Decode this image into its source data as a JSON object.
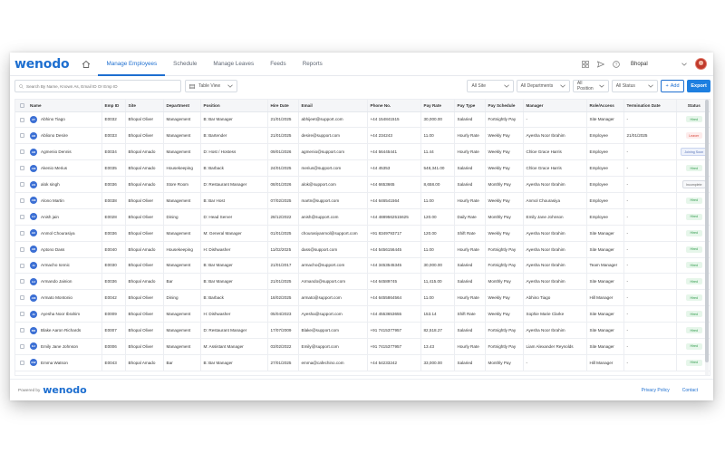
{
  "app": {
    "logo": "wenodo"
  },
  "nav": {
    "home_icon": "home-icon",
    "tabs": [
      {
        "label": "Manage Employees",
        "active": true
      },
      {
        "label": "Schedule"
      },
      {
        "label": "Manage Leaves"
      },
      {
        "label": "Feeds"
      },
      {
        "label": "Reports"
      }
    ]
  },
  "header": {
    "site_selected": "Bhopal"
  },
  "toolbar": {
    "search_placeholder": "Search By Name, Known As, Email ID Or Emp ID",
    "view_label": "Table View",
    "filters": {
      "site": "All Site",
      "department": "All Departments",
      "position": "All Position",
      "status": "All Status"
    },
    "add_label": "Add",
    "export_label": "Export"
  },
  "table": {
    "columns": [
      "Name",
      "Emp ID",
      "Site",
      "Department",
      "Position",
      "Hire Date",
      "Email",
      "Phone No.",
      "Pay Rate",
      "Pay Type",
      "Pay Schedule",
      "Manager",
      "Role/Access",
      "Termination Date",
      "Status"
    ],
    "rows": [
      {
        "initials": "AT",
        "name": "Abhino Tiago",
        "emp_id": "E0032",
        "site": "Bhopal Oliver",
        "department": "Management",
        "position": "B: Bar Manager",
        "hire_date": "21/01/2025",
        "email": "abhijeet@support.com",
        "phone": "+44 154841515",
        "pay_rate": "30,000.00",
        "pay_type": "Salaried",
        "pay_schedule": "Fortnightly Pay",
        "manager": "-",
        "role": "Site Manager",
        "termination": "-",
        "status": "Hired",
        "status_kind": "hired"
      },
      {
        "initials": "AD",
        "name": "Abliono Desire",
        "emp_id": "E0033",
        "site": "Bhopal Oliver",
        "department": "Management",
        "position": "B: Bartender",
        "hire_date": "21/01/2025",
        "email": "desire@support.com",
        "phone": "+44 234243",
        "pay_rate": "11.00",
        "pay_type": "Hourly Rate",
        "pay_schedule": "Weekly Pay",
        "manager": "Ayesha Noor Ibrahim",
        "role": "Employee",
        "termination": "21/01/2025",
        "status": "Leaver",
        "status_kind": "leaver"
      },
      {
        "initials": "AD",
        "name": "Agmenio Dennis",
        "emp_id": "E0034",
        "site": "Bhopal Amado",
        "department": "Management",
        "position": "D: Host / Hostess",
        "hire_date": "09/01/2026",
        "email": "agmenio@support.com",
        "phone": "+44 56445441",
        "pay_rate": "11.44",
        "pay_type": "Hourly Rate",
        "pay_schedule": "Weekly Pay",
        "manager": "Chloe Grace Harris",
        "role": "Employee",
        "termination": "-",
        "status": "Joining Soon",
        "status_kind": "joining"
      },
      {
        "initials": "AM",
        "name": "Akenio Merius",
        "emp_id": "E0035",
        "site": "Bhopal Amado",
        "department": "Housekeeping",
        "position": "B: Barback",
        "hire_date": "24/01/2025",
        "email": "merius@support.com",
        "phone": "+44 45353",
        "pay_rate": "548,341.00",
        "pay_type": "Salaried",
        "pay_schedule": "Weekly Pay",
        "manager": "Chloe Grace Harris",
        "role": "Employee",
        "termination": "-",
        "status": "Hired",
        "status_kind": "hired"
      },
      {
        "initials": "AS",
        "name": "alok singh",
        "emp_id": "E0036",
        "site": "Bhopal Amado",
        "department": "Store Room",
        "position": "D: Restaurant Manager",
        "hire_date": "08/01/2026",
        "email": "alok@support.com",
        "phone": "+44 6653665",
        "pay_rate": "8,658.00",
        "pay_type": "Salaried",
        "pay_schedule": "Monthly Pay",
        "manager": "Ayesha Noor Ibrahim",
        "role": "Employee",
        "termination": "-",
        "status": "Incomplete",
        "status_kind": "incomplete"
      },
      {
        "initials": "AM",
        "name": "Alono Martin",
        "emp_id": "E0038",
        "site": "Bhopal Oliver",
        "department": "Management",
        "position": "B: Bar Host",
        "hire_date": "07/02/2025",
        "email": "martn@support.com",
        "phone": "+44 646541564",
        "pay_rate": "11.00",
        "pay_type": "Hourly Rate",
        "pay_schedule": "Weekly Pay",
        "manager": "Anmol Chourasiya",
        "role": "Employee",
        "termination": "-",
        "status": "Hired",
        "status_kind": "hired"
      },
      {
        "initials": "AJ",
        "name": "Anish jain",
        "emp_id": "E0028",
        "site": "Bhopal Oliver",
        "department": "Dining",
        "position": "D: Head Server",
        "hire_date": "28/12/2022",
        "email": "anish@support.com",
        "phone": "+44 4889562515625",
        "pay_rate": "120.00",
        "pay_type": "Daily Rate",
        "pay_schedule": "Monthly Pay",
        "manager": "Emily Jane Johnson",
        "role": "Employee",
        "termination": "-",
        "status": "Hired",
        "status_kind": "hired"
      },
      {
        "initials": "AC",
        "name": "Anmol Chourasiya",
        "emp_id": "E0036",
        "site": "Bhopal Oliver",
        "department": "Management",
        "position": "M: General Manager",
        "hire_date": "01/01/2025",
        "email": "chourasiyanmol@support.com",
        "phone": "+91 8349793717",
        "pay_rate": "120.00",
        "pay_type": "Shift Rate",
        "pay_schedule": "Weekly Pay",
        "manager": "Ayesha Noor Ibrahim",
        "role": "Site Manager",
        "termination": "-",
        "status": "Hired",
        "status_kind": "hired"
      },
      {
        "initials": "AD",
        "name": "Aptono Dass",
        "emp_id": "E0040",
        "site": "Bhopal Amado",
        "department": "Housekeeping",
        "position": "H: Dishwasher",
        "hire_date": "11/02/2025",
        "email": "dass@support.com",
        "phone": "+44 5456156445",
        "pay_rate": "11.00",
        "pay_type": "Hourly Rate",
        "pay_schedule": "Fortnightly Pay",
        "manager": "Ayesha Noor Ibrahim",
        "role": "Site Manager",
        "termination": "-",
        "status": "Hired",
        "status_kind": "hired"
      },
      {
        "initials": "AI",
        "name": "Armacho Ionnic",
        "emp_id": "E0030",
        "site": "Bhopal Oliver",
        "department": "Management",
        "position": "B: Bar Manager",
        "hire_date": "21/01/2017",
        "email": "armacho@support.com",
        "phone": "+44 3453545345",
        "pay_rate": "30,000.00",
        "pay_type": "Salaried",
        "pay_schedule": "Fortnightly Pay",
        "manager": "Ayesha Noor Ibrahim",
        "role": "Team Manager",
        "termination": "-",
        "status": "Hired",
        "status_kind": "hired"
      },
      {
        "initials": "AJ",
        "name": "Armando Jainion",
        "emp_id": "E0036",
        "site": "Bhopal Amado",
        "department": "Bar",
        "position": "B: Bar Manager",
        "hire_date": "21/01/2025",
        "email": "Armando@support.com",
        "phone": "+44 64589745",
        "pay_rate": "11,415.00",
        "pay_type": "Salaried",
        "pay_schedule": "Monthly Pay",
        "manager": "Ayesha Noor Ibrahim",
        "role": "Site Manager",
        "termination": "-",
        "status": "Hired",
        "status_kind": "hired"
      },
      {
        "initials": "AM",
        "name": "Armato Montonio",
        "emp_id": "E0042",
        "site": "Bhopal Oliver",
        "department": "Dining",
        "position": "B: Barback",
        "hire_date": "18/02/2025",
        "email": "armato@support.com",
        "phone": "+44 6455864564",
        "pay_rate": "11.00",
        "pay_type": "Hourly Rate",
        "pay_schedule": "Weekly Pay",
        "manager": "Abhino Tiago",
        "role": "Hill Manager",
        "termination": "-",
        "status": "Hired",
        "status_kind": "hired"
      },
      {
        "initials": "AI",
        "name": "Ayesha Noor Ibrahim",
        "emp_id": "E0009",
        "site": "Bhopal Oliver",
        "department": "Management",
        "position": "H: Dishwasher",
        "hire_date": "05/04/2023",
        "email": "Ayesha@support.com",
        "phone": "+44 4553653655",
        "pay_rate": "153.14",
        "pay_type": "Shift Rate",
        "pay_schedule": "Weekly Pay",
        "manager": "Sophie Marie Clarke",
        "role": "Site Manager",
        "termination": "-",
        "status": "Hired",
        "status_kind": "hired"
      },
      {
        "initials": "BR",
        "name": "Blake Aaron Richards",
        "emp_id": "E0007",
        "site": "Bhopal Oliver",
        "department": "Management",
        "position": "D: Restaurant Manager",
        "hire_date": "17/07/2009",
        "email": "Blake@support.com",
        "phone": "+91 7415377957",
        "pay_rate": "82,518.27",
        "pay_type": "Salaried",
        "pay_schedule": "Fortnightly Pay",
        "manager": "Ayesha Noor Ibrahim",
        "role": "Site Manager",
        "termination": "-",
        "status": "Hired",
        "status_kind": "hired"
      },
      {
        "initials": "EJ",
        "name": "Emily Jane Johnson",
        "emp_id": "E0006",
        "site": "Bhopal Oliver",
        "department": "Management",
        "position": "M: Assistant Manager",
        "hire_date": "03/02/2022",
        "email": "Emily@support.com",
        "phone": "+91 7415377957",
        "pay_rate": "13.43",
        "pay_type": "Hourly Rate",
        "pay_schedule": "Fortnightly Pay",
        "manager": "Liam Alexander Reynolds",
        "role": "Site Manager",
        "termination": "-",
        "status": "Hired",
        "status_kind": "hired"
      },
      {
        "initials": "EW",
        "name": "Emma Watson",
        "emp_id": "E0043",
        "site": "Bhopal Amado",
        "department": "Bar",
        "position": "B: Bar Manager",
        "hire_date": "27/01/2025",
        "email": "emma@cafechino.com",
        "phone": "+44 54233242",
        "pay_rate": "33,000.00",
        "pay_type": "Salaried",
        "pay_schedule": "Monthly Pay",
        "manager": "-",
        "role": "Hill Manager",
        "termination": "-",
        "status": "Hired",
        "status_kind": "hired"
      }
    ]
  },
  "footer": {
    "powered_by": "Powered by",
    "logo": "wenodo",
    "links": [
      "Privacy Policy",
      "Contact"
    ]
  },
  "colors": {
    "brand": "#1e6fd0",
    "hired": "#2f9a4a",
    "leaver": "#d9473b",
    "avatar_blue": "#3b6fd4"
  }
}
